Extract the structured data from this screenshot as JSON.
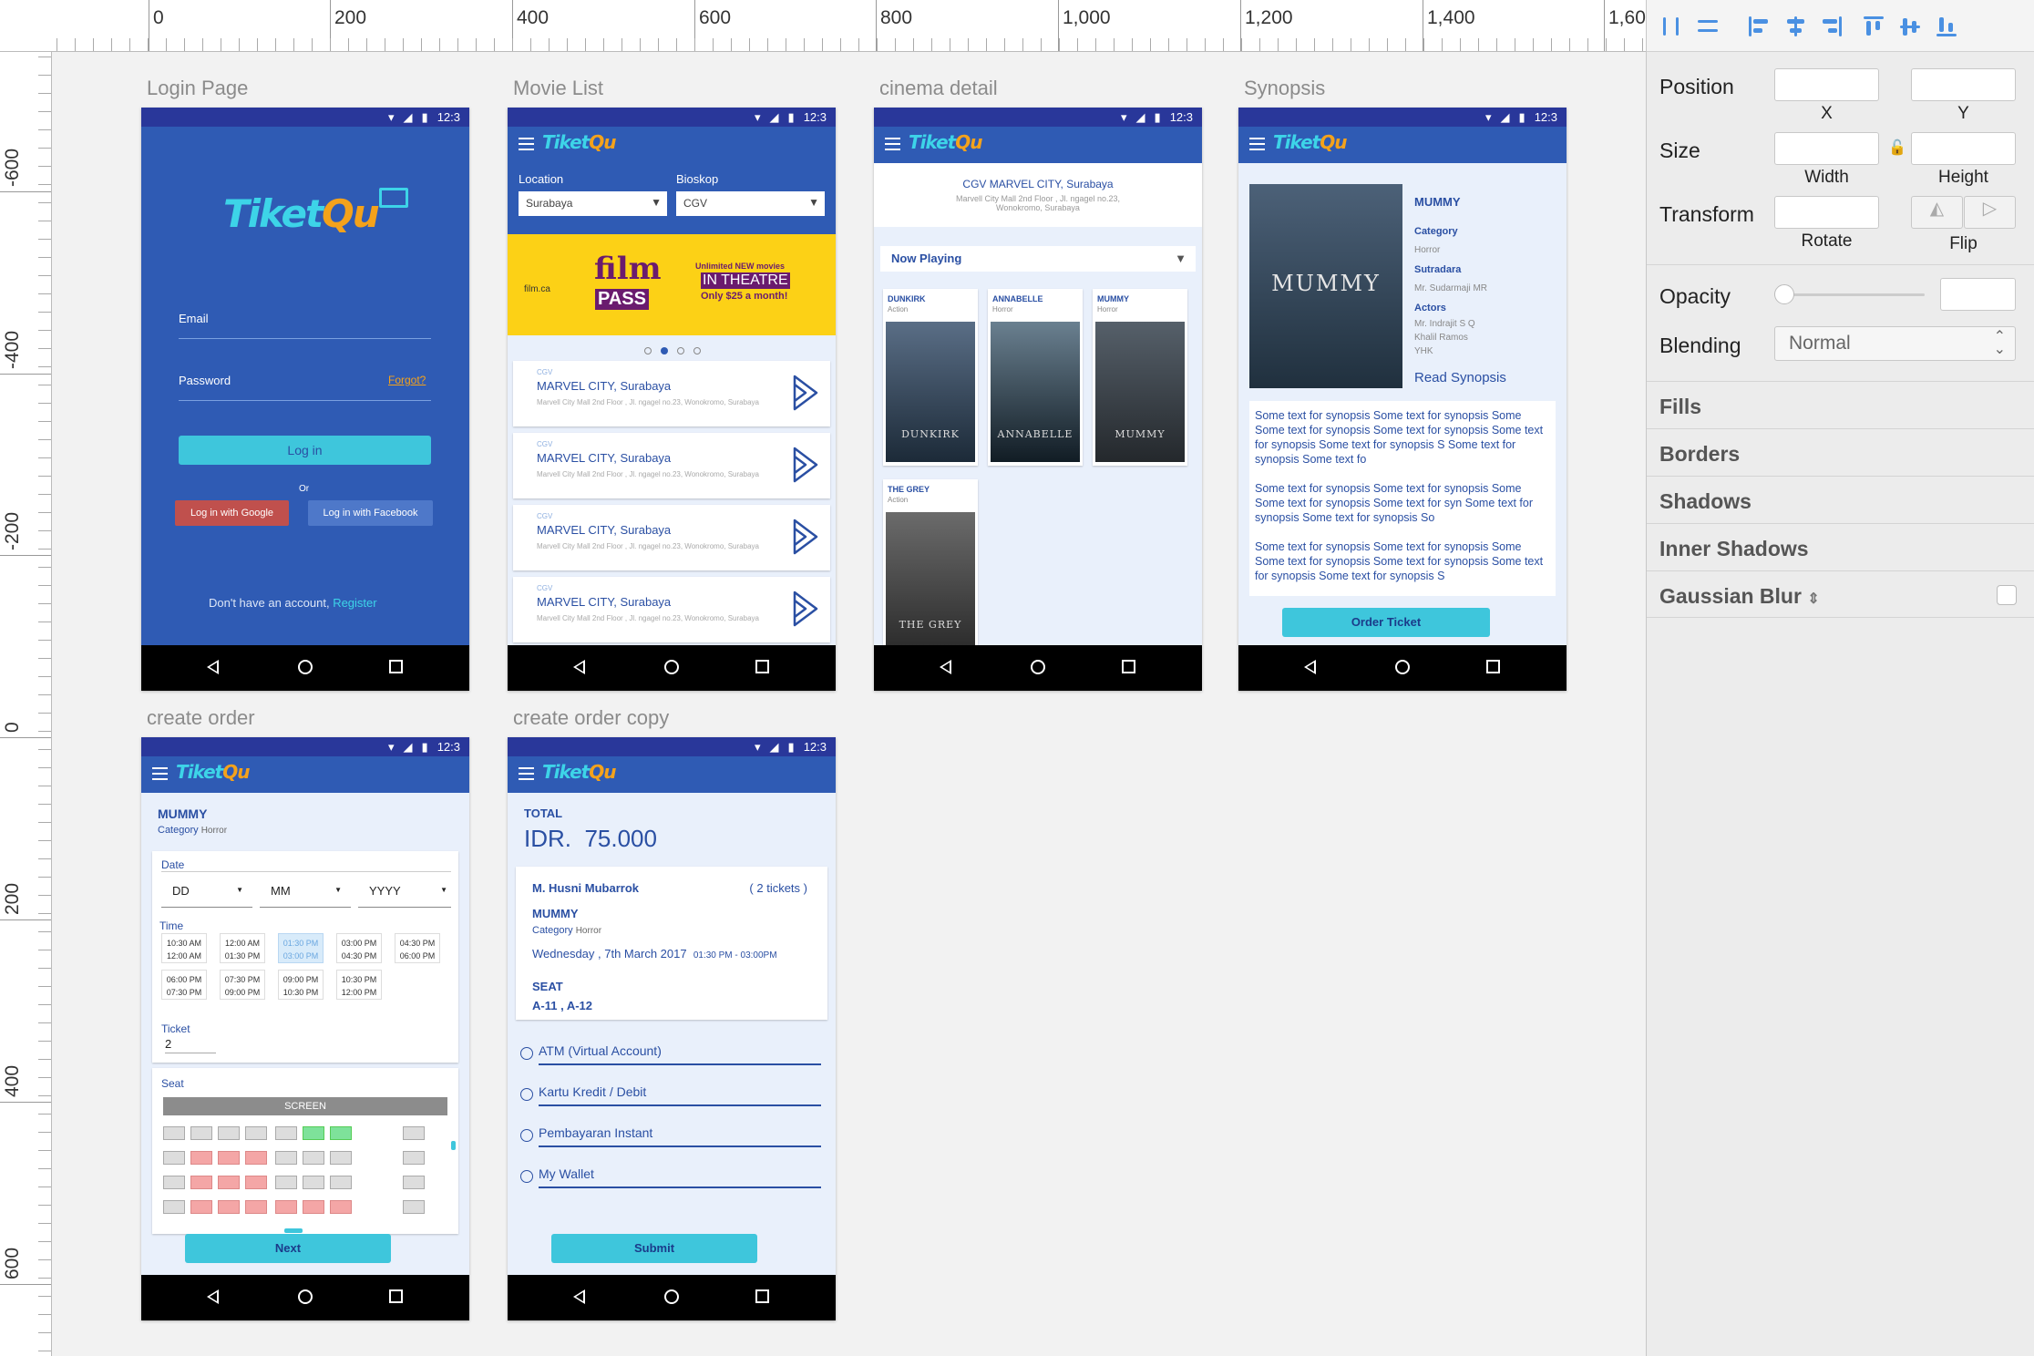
{
  "ruler": {
    "h_labels": [
      "0",
      "200",
      "400",
      "600",
      "800",
      "1,000",
      "1,200",
      "1,400",
      "1,60"
    ],
    "v_labels": [
      "-600",
      "-400",
      "-200",
      "0",
      "200",
      "400",
      "600"
    ]
  },
  "inspector": {
    "position": "Position",
    "x": "X",
    "y": "Y",
    "size": "Size",
    "width": "Width",
    "height": "Height",
    "transform": "Transform",
    "rotate": "Rotate",
    "flip": "Flip",
    "opacity": "Opacity",
    "blending": "Blending",
    "blend_value": "Normal",
    "sections": [
      "Fills",
      "Borders",
      "Shadows",
      "Inner Shadows",
      "Gaussian Blur"
    ]
  },
  "status": {
    "time": "12:3"
  },
  "logo": {
    "a": "Tiket",
    "b": "Qu"
  },
  "artboards": {
    "login": "Login Page",
    "movie_list": "Movie List",
    "cinema": "cinema detail",
    "synopsis": "Synopsis",
    "order": "create order",
    "order_copy": "create order copy"
  },
  "login": {
    "email": "Email",
    "password": "Password",
    "forgot": "Forgot?",
    "login_btn": "Log in",
    "or": "Or",
    "google": "Log in with Google",
    "facebook": "Log in with Facebook",
    "no_account": "Don't have an account, ",
    "register": "Register"
  },
  "movie_list": {
    "location_label": "Location",
    "bioskop_label": "Bioskop",
    "location_value": "Surabaya",
    "bioskop_value": "CGV",
    "banner": {
      "film": "film",
      "pass": "PASS",
      "brand": "film.ca",
      "line1": "Unlimited NEW movies",
      "line2": "IN THEATRE",
      "line3": "Only $25 a month!"
    },
    "items": [
      {
        "tag": "CGV",
        "name": "MARVEL CITY, Surabaya",
        "addr": "Marvell City Mall 2nd Floor , Jl. ngagel no.23, Wonokromo, Surabaya"
      },
      {
        "tag": "CGV",
        "name": "MARVEL CITY, Surabaya",
        "addr": "Marvell City Mall 2nd Floor , Jl. ngagel no.23, Wonokromo, Surabaya"
      },
      {
        "tag": "CGV",
        "name": "MARVEL CITY, Surabaya",
        "addr": "Marvell City Mall 2nd Floor , Jl. ngagel no.23, Wonokromo, Surabaya"
      },
      {
        "tag": "CGV",
        "name": "MARVEL CITY, Surabaya",
        "addr": "Marvell City Mall 2nd Floor , Jl. ngagel no.23, Wonokromo, Surabaya"
      }
    ]
  },
  "cinema": {
    "name": "CGV MARVEL CITY, Surabaya",
    "addr1": "Marvell City Mall 2nd Floor , Jl. ngagel no.23,",
    "addr2": "Wonokromo, Surabaya",
    "now_playing": "Now Playing",
    "movies": [
      {
        "title": "DUNKIRK",
        "genre": "Action",
        "poster": "DUNKIRK"
      },
      {
        "title": "ANNABELLE",
        "genre": "Horror",
        "poster": "ANNABELLE"
      },
      {
        "title": "MUMMY",
        "genre": "Horror",
        "poster": "MUMMY"
      },
      {
        "title": "THE GREY",
        "genre": "Action",
        "poster": "THE GREY"
      }
    ]
  },
  "synopsis": {
    "title": "MUMMY",
    "cat_label": "Category",
    "cat": "Horror",
    "dir_label": "Sutradara",
    "dir": "Mr. Sudarmaji MR",
    "act_label": "Actors",
    "actors": [
      "Mr. Indrajit S Q",
      "Khalil Ramos",
      "YHK"
    ],
    "read": "Read Synopsis",
    "poster": "MUMMY",
    "paras": [
      "Some text for synopsis Some text for synopsis Some Some text for synopsis Some text for synopsis Some text for synopsis Some text for synopsis S Some text for synopsis Some text fo",
      "Some text for synopsis Some text for synopsis Some Some text for synopsis Some text for syn Some text for synopsis Some text for synopsis So",
      "Some text for synopsis Some text for synopsis Some Some text for synopsis Some text for synopsis Some text for synopsis Some text for synopsis S"
    ],
    "order": "Order Ticket"
  },
  "order": {
    "title": "MUMMY",
    "cat_label": "Category",
    "cat": "Horror",
    "date_label": "Date",
    "dd": "DD",
    "mm": "MM",
    "yyyy": "YYYY",
    "time_label": "Time",
    "times": [
      [
        "10:30 AM",
        "12:00 AM"
      ],
      [
        "12:00 AM",
        "01:30 PM"
      ],
      [
        "01:30 PM",
        "03:00 PM"
      ],
      [
        "03:00 PM",
        "04:30 PM"
      ],
      [
        "04:30 PM",
        "06:00 PM"
      ],
      [
        "06:00 PM",
        "07:30 PM"
      ],
      [
        "07:30 PM",
        "09:00 PM"
      ],
      [
        "09:00 PM",
        "10:30 PM"
      ],
      [
        "10:30 PM",
        "12:00 PM"
      ]
    ],
    "ticket_label": "Ticket",
    "ticket_value": "2",
    "seat_label": "Seat",
    "screen": "SCREEN",
    "next": "Next"
  },
  "confirm": {
    "total_label": "TOTAL",
    "currency": "IDR.",
    "amount": "75.000",
    "name": "M. Husni Mubarrok",
    "tickets": "( 2 tickets )",
    "movie": "MUMMY",
    "cat_label": "Category",
    "cat": "Horror",
    "date": "Wednesday , 7th March 2017",
    "time": "01:30 PM - 03:00PM",
    "seat_label": "SEAT",
    "seats": "A-11 , A-12",
    "payments": [
      "ATM (Virtual Account)",
      "Kartu Kredit / Debit",
      "Pembayaran Instant",
      "My Wallet"
    ],
    "submit": "Submit"
  }
}
